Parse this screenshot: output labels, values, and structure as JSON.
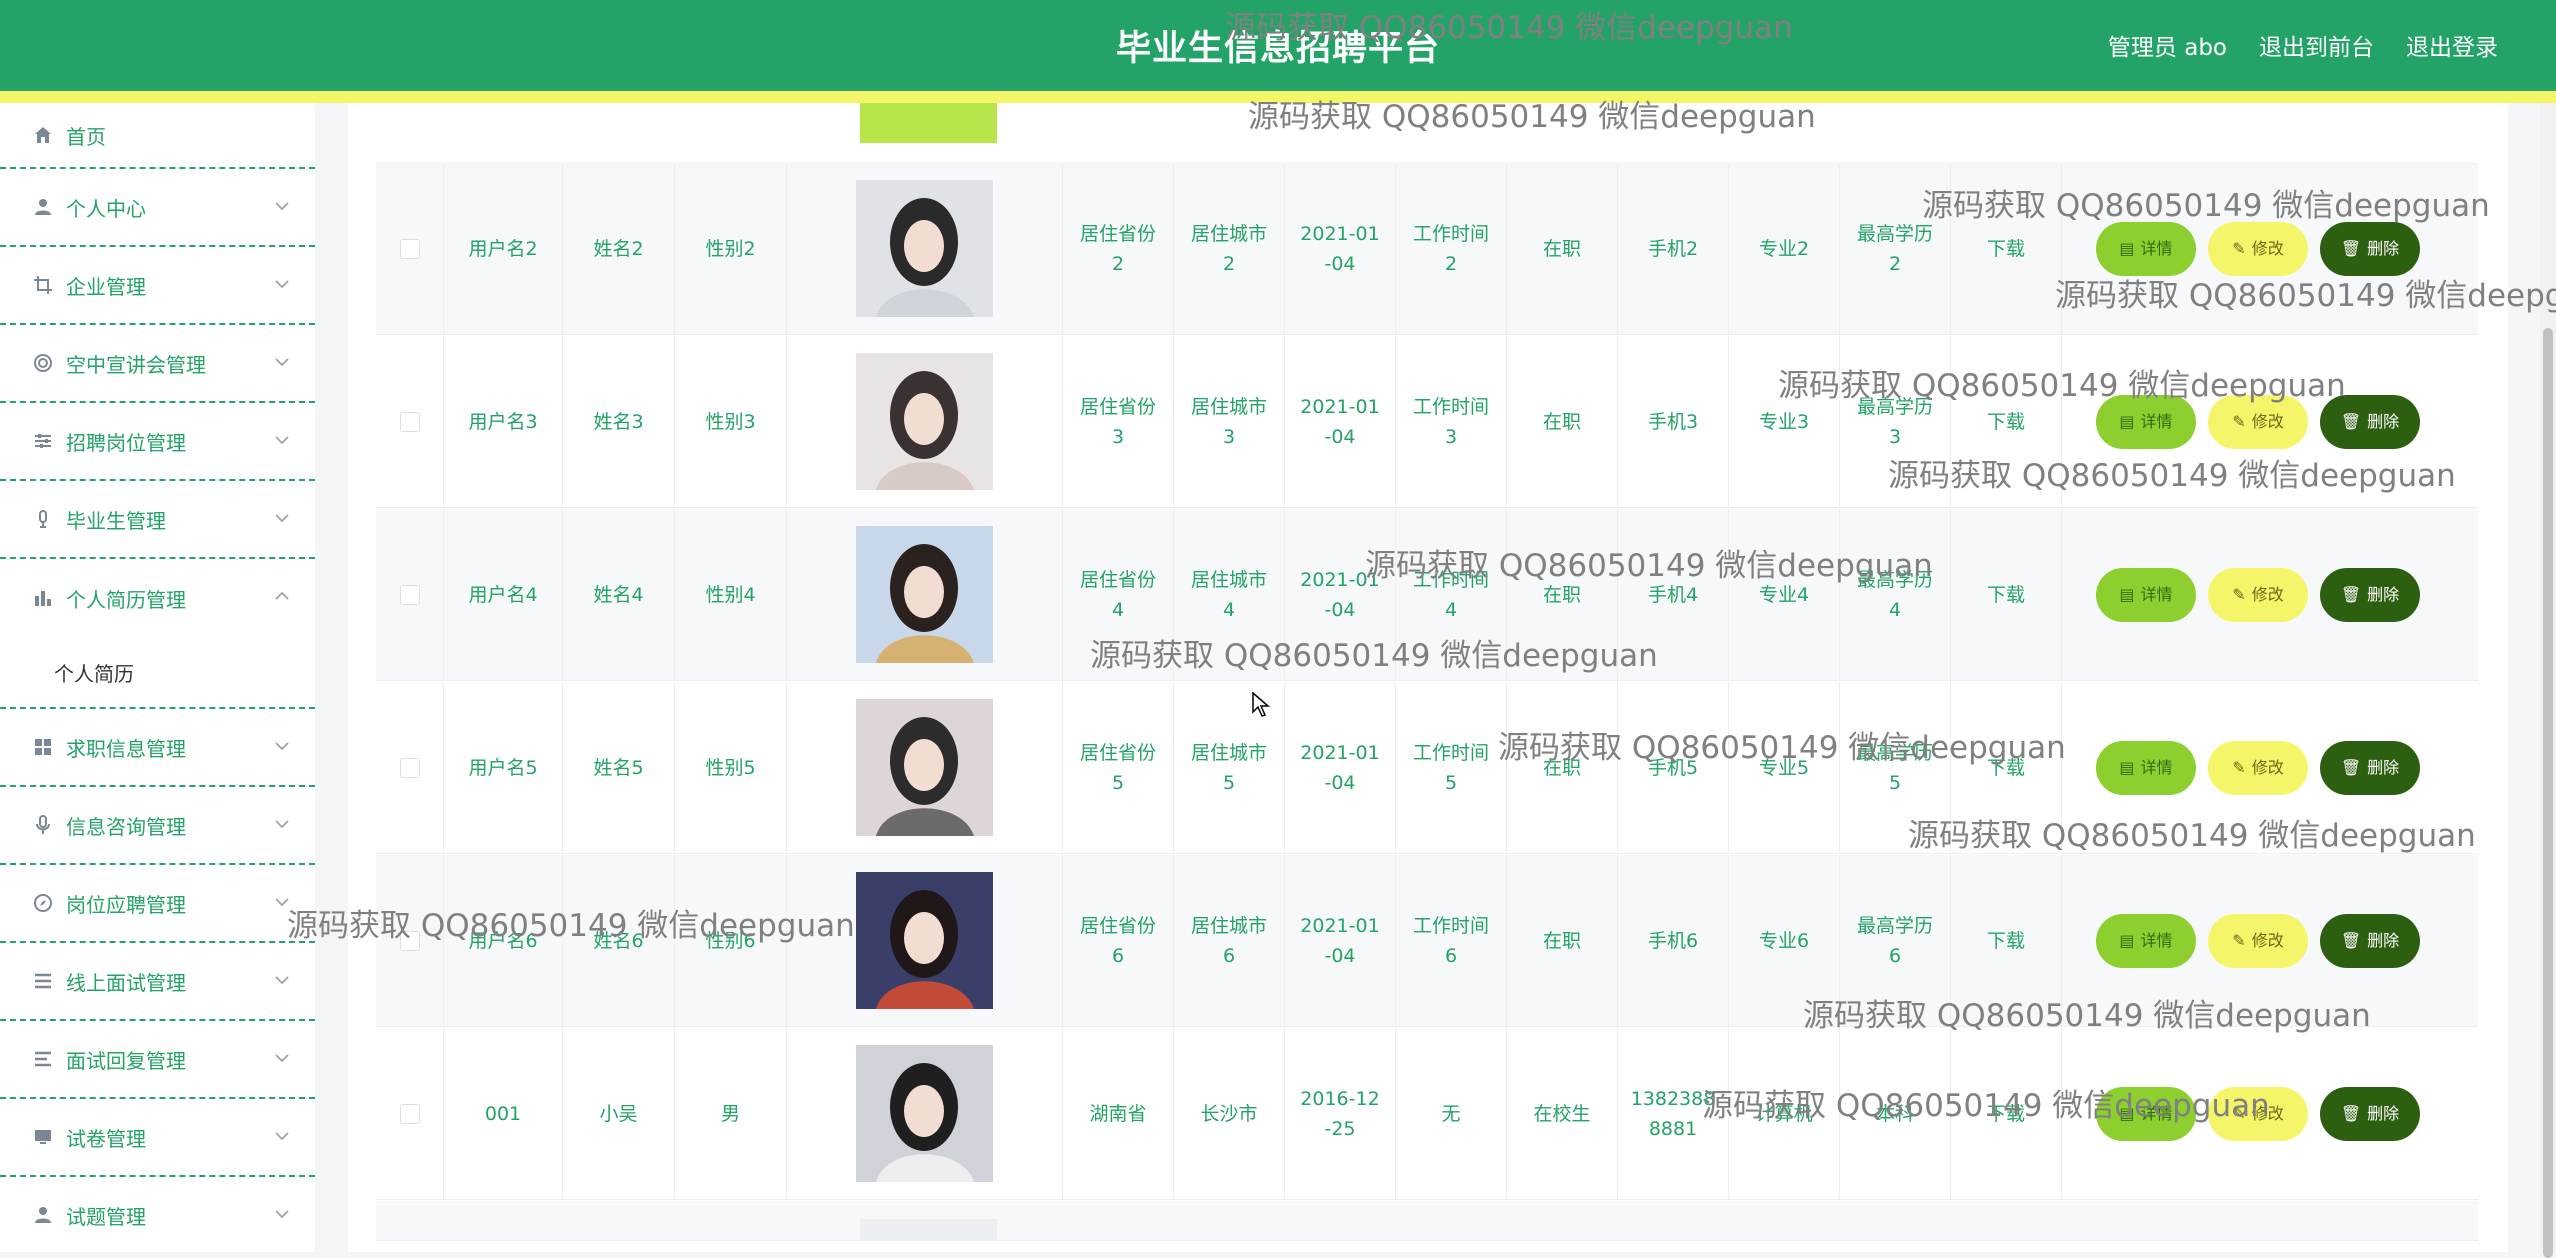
{
  "header": {
    "title": "毕业生信息招聘平台",
    "nav": [
      "管理员 abo",
      "退出到前台",
      "退出登录"
    ]
  },
  "sidebar": {
    "items": [
      {
        "label": "首页",
        "icon": "home-icon",
        "expanded": false,
        "has_arrow": false
      },
      {
        "label": "个人中心",
        "icon": "user-icon",
        "has_arrow": true
      },
      {
        "label": "企业管理",
        "icon": "crop-icon",
        "has_arrow": true
      },
      {
        "label": "空中宣讲会管理",
        "icon": "target-icon",
        "has_arrow": true
      },
      {
        "label": "招聘岗位管理",
        "icon": "sliders-icon",
        "has_arrow": true
      },
      {
        "label": "毕业生管理",
        "icon": "microphone-icon",
        "has_arrow": true
      },
      {
        "label": "个人简历管理",
        "icon": "bar-chart-icon",
        "has_arrow": true,
        "expanded": true,
        "children": [
          "个人简历"
        ]
      },
      {
        "label": "求职信息管理",
        "icon": "grid-icon",
        "has_arrow": true
      },
      {
        "label": "信息咨询管理",
        "icon": "mic-icon",
        "has_arrow": true
      },
      {
        "label": "岗位应聘管理",
        "icon": "compass-icon",
        "has_arrow": true
      },
      {
        "label": "线上面试管理",
        "icon": "list-icon",
        "has_arrow": true
      },
      {
        "label": "面试回复管理",
        "icon": "menu-icon",
        "has_arrow": true
      },
      {
        "label": "试卷管理",
        "icon": "monitor-icon",
        "has_arrow": true
      },
      {
        "label": "试题管理",
        "icon": "user-icon",
        "has_arrow": true
      }
    ]
  },
  "table": {
    "buttons": {
      "detail": "详情",
      "edit": "修改",
      "delete": "删除"
    },
    "download_label": "下载",
    "rows": [
      {
        "username": "用户名2",
        "name": "姓名2",
        "gender": "性别2",
        "province": "居住省份\n2",
        "city": "居住城市\n2",
        "date": "2021-01\n-04",
        "work_time": "工作时间\n2",
        "status": "在职",
        "phone": "手机2",
        "major": "专业2",
        "edu": "最高学历\n2"
      },
      {
        "username": "用户名3",
        "name": "姓名3",
        "gender": "性别3",
        "province": "居住省份\n3",
        "city": "居住城市\n3",
        "date": "2021-01\n-04",
        "work_time": "工作时间\n3",
        "status": "在职",
        "phone": "手机3",
        "major": "专业3",
        "edu": "最高学历\n3"
      },
      {
        "username": "用户名4",
        "name": "姓名4",
        "gender": "性别4",
        "province": "居住省份\n4",
        "city": "居住城市\n4",
        "date": "2021-01\n-04",
        "work_time": "工作时间\n4",
        "status": "在职",
        "phone": "手机4",
        "major": "专业4",
        "edu": "最高学历\n4"
      },
      {
        "username": "用户名5",
        "name": "姓名5",
        "gender": "性别5",
        "province": "居住省份\n5",
        "city": "居住城市\n5",
        "date": "2021-01\n-04",
        "work_time": "工作时间\n5",
        "status": "在职",
        "phone": "手机5",
        "major": "专业5",
        "edu": "最高学历\n5"
      },
      {
        "username": "用户名6",
        "name": "姓名6",
        "gender": "性别6",
        "province": "居住省份\n6",
        "city": "居住城市\n6",
        "date": "2021-01\n-04",
        "work_time": "工作时间\n6",
        "status": "在职",
        "phone": "手机6",
        "major": "专业6",
        "edu": "最高学历\n6"
      },
      {
        "username": "001",
        "name": "小吴",
        "gender": "男",
        "province": "湖南省",
        "city": "长沙市",
        "date": "2016-12\n-25",
        "work_time": "无",
        "status": "在校生",
        "phone": "1382388\n8881",
        "major": "计算机",
        "edu": "本科"
      }
    ]
  },
  "watermark": "源码获取 QQ86050149 微信deepguan",
  "colors": {
    "primary": "#23a368",
    "accent_yellow": "#f5f56a",
    "detail_btn": "#8ccf2f",
    "delete_btn": "#2d5f10"
  }
}
